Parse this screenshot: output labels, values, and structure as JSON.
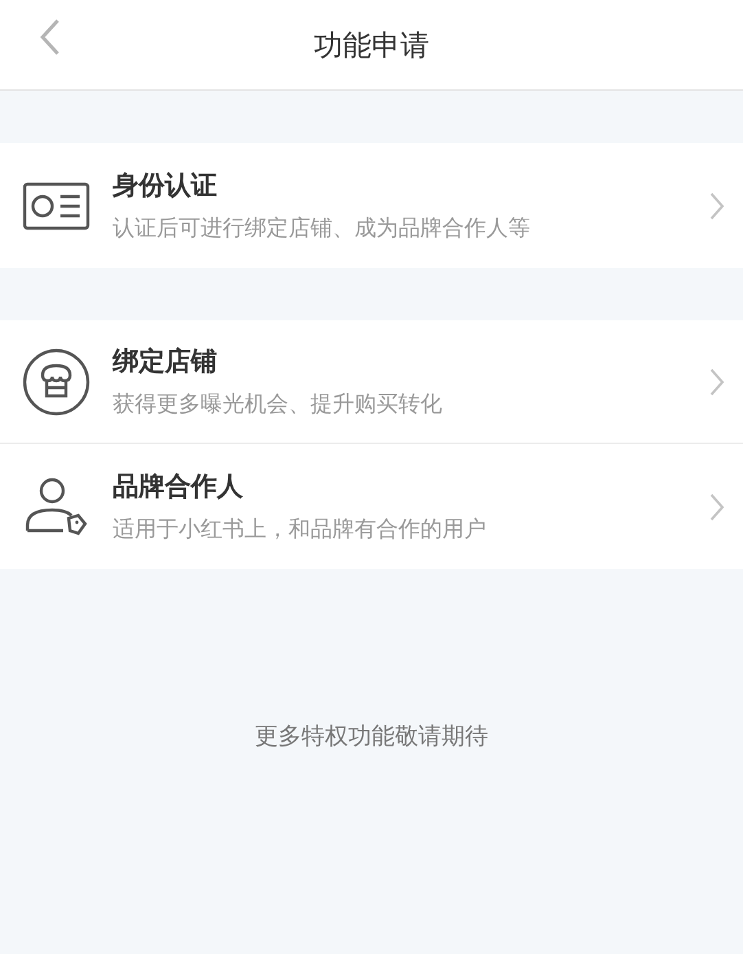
{
  "header": {
    "title": "功能申请"
  },
  "sections": [
    {
      "items": [
        {
          "kind": "id-card",
          "title": "身份认证",
          "subtitle": "认证后可进行绑定店铺、成为品牌合作人等"
        }
      ]
    },
    {
      "items": [
        {
          "kind": "store",
          "title": "绑定店铺",
          "subtitle": "获得更多曝光机会、提升购买转化"
        },
        {
          "kind": "partner",
          "title": "品牌合作人",
          "subtitle": "适用于小红书上，和品牌有合作的用户"
        }
      ]
    }
  ],
  "footer_note": "更多特权功能敬请期待"
}
